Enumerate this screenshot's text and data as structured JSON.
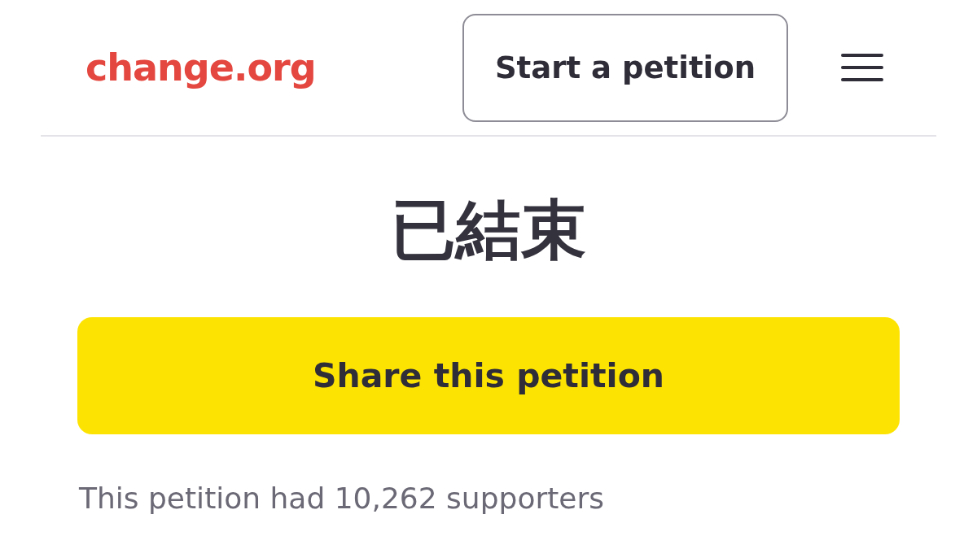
{
  "header": {
    "logo": "change.org",
    "start_button": "Start a petition"
  },
  "status": "已結束",
  "share_button": "Share this petition",
  "supporters_text": "This petition had 10,262 supporters"
}
